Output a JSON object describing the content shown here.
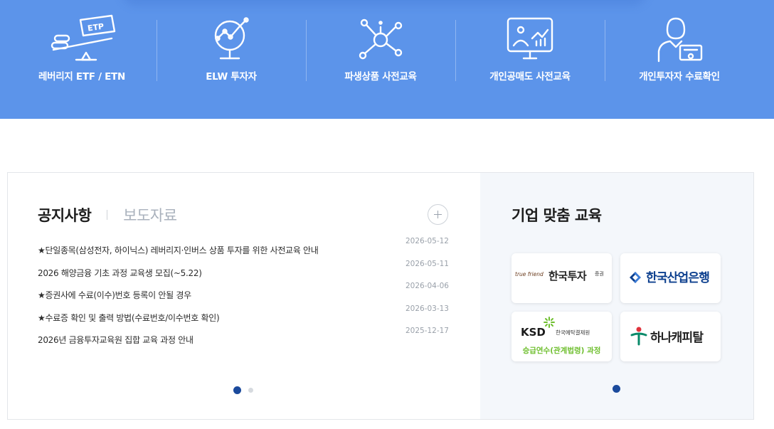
{
  "top_menu": {
    "items": [
      {
        "label": "레버리지 ETF / ETN",
        "icon": "etp-scale-icon"
      },
      {
        "label": "ELW 투자자",
        "icon": "chart-magnifier-icon"
      },
      {
        "label": "파생상품 사전교육",
        "icon": "network-nodes-icon"
      },
      {
        "label": "개인공매도 사전교육",
        "icon": "monitor-chart-icon"
      },
      {
        "label": "개인투자자 수료확인",
        "icon": "person-certificate-icon"
      }
    ],
    "etp_badge": "ETP",
    "colors": {
      "background": "#5c94ea",
      "text": "#ffffff"
    }
  },
  "notice": {
    "tab_active": "공지사항",
    "tab_inactive": "보도자료",
    "more_icon": "plus-icon",
    "items": [
      {
        "title": "★단일종목(삼성전자, 하이닉스) 레버리지·인버스 상품 투자를 위한 사전교육 안내",
        "date": "2026-05-12"
      },
      {
        "title": "2026 해양금융 기초 과정 교육생 모집(~5.22)",
        "date": "2026-05-11"
      },
      {
        "title": "★증권사에 수료(이수)번호 등록이 안될 경우",
        "date": "2026-04-06"
      },
      {
        "title": "★수료증 확인 및 출력 방법(수료번호/이수번호 확인)",
        "date": "2026-03-13"
      },
      {
        "title": "2026년 금융투자교육원 집합 교육 과정 안내",
        "date": "2025-12-17"
      }
    ],
    "pager": {
      "count": 2,
      "active": 1
    }
  },
  "corporate": {
    "title": "기업 맞춤 교육",
    "logos": {
      "korea_investment": {
        "tagline": "true friend",
        "name": "한국투자",
        "suffix": "증권"
      },
      "kdb": {
        "name": "한국산업은행"
      },
      "ksd": {
        "abbr": "KSD",
        "name": "한국예탁결제원",
        "course": "승급연수(관계법령) 과정"
      },
      "hana": {
        "name": "하나캐피탈"
      }
    },
    "pager": {
      "count": 1,
      "active": 1
    },
    "colors": {
      "background": "#f4f7fb",
      "pager_active": "#1b4a9c",
      "ksd_green": "#6fbf2f",
      "kdb_blue": "#0c3f8e"
    }
  }
}
